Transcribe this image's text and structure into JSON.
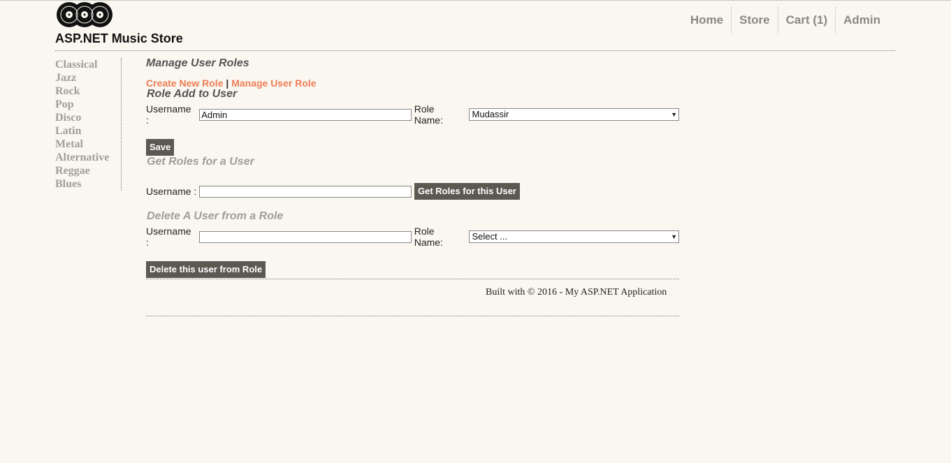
{
  "site": {
    "title": "ASP.NET Music Store"
  },
  "nav": {
    "items": [
      "Home",
      "Store",
      "Cart (1)",
      "Admin"
    ]
  },
  "genres": [
    "Classical",
    "Jazz",
    "Rock",
    "Pop",
    "Disco",
    "Latin",
    "Metal",
    "Alternative",
    "Reggae",
    "Blues"
  ],
  "page": {
    "heading": "Manage User Roles",
    "link_create": "Create New Role",
    "separator": "|",
    "link_manage": "Manage User Role"
  },
  "add_section": {
    "heading": "Role Add to User",
    "username_label": "Username :",
    "username_value": "Admin",
    "role_label": "Role Name:",
    "role_value": "Mudassir",
    "save_label": "Save"
  },
  "get_section": {
    "heading": "Get Roles for a User",
    "username_label": "Username :",
    "username_value": "",
    "button_label": "Get Roles for this User"
  },
  "delete_section": {
    "heading": "Delete A User from a Role",
    "username_label": "Username :",
    "username_value": "",
    "role_label": "Role Name:",
    "role_value": "Select ...",
    "button_label": "Delete this user from Role"
  },
  "footer": {
    "text": "Built with © 2016 - My ASP.NET Application"
  },
  "colors": {
    "background": "#f9f7f0",
    "link_accent": "#ef7d55",
    "button": "#5c5852",
    "muted": "#a09e98"
  }
}
